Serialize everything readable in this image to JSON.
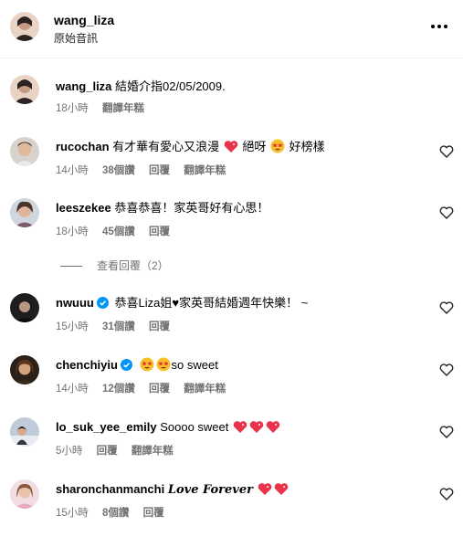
{
  "header": {
    "username": "wang_liza",
    "subtitle": "原始音訊",
    "more_icon": "more-horizontal-icon"
  },
  "caption": {
    "username": "wang_liza",
    "text": "結婚介指02/05/2009.",
    "time": "18小時",
    "translate": "翻譯年糕"
  },
  "comments": [
    {
      "username": "rucochan",
      "verified": false,
      "text_a": "有才華有愛心又浪漫",
      "text_b": "絕呀",
      "text_c": "好榜樣",
      "time": "14小時",
      "likes": "38個讚",
      "reply": "回覆",
      "translate": "翻譯年糕",
      "avatar_color": "#c9b7a6"
    },
    {
      "username": "leeszekee",
      "verified": false,
      "text": "恭喜恭喜！家英哥好有心思！",
      "time": "18小時",
      "likes": "45個讚",
      "reply": "回覆",
      "avatar_color": "#b48a7a"
    },
    {
      "username": "nwuuu",
      "verified": true,
      "text_a": "恭喜Liza姐",
      "text_b": "家英哥結婚週年快樂！ ~",
      "time": "15小時",
      "likes": "31個讚",
      "reply": "回覆",
      "avatar_color": "#3a3a3a"
    },
    {
      "username": "chenchiyiu",
      "verified": true,
      "text": "so sweet",
      "time": "14小時",
      "likes": "12個讚",
      "reply": "回覆",
      "translate": "翻譯年糕",
      "avatar_color": "#6b4a2c"
    },
    {
      "username": "lo_suk_yee_emily",
      "verified": false,
      "text": "Soooo sweet",
      "time": "5小時",
      "reply": "回覆",
      "translate": "翻譯年糕",
      "avatar_color": "#9fb0c4"
    },
    {
      "username": "sharonchanmanchi",
      "verified": false,
      "text": "Love Forever",
      "time": "15小時",
      "likes": "8個讚",
      "reply": "回覆",
      "avatar_color": "#e8c6cf"
    }
  ],
  "view_replies": "查看回覆（2）",
  "colors": {
    "heart": "#ed1d48",
    "verified": "#0095f6",
    "meta": "#737373"
  }
}
